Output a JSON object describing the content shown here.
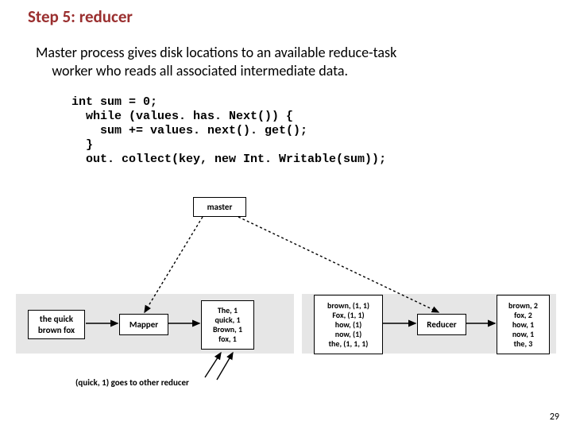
{
  "title": "Step 5: reducer",
  "desc_line1": "Master process gives disk locations to an available reduce-task",
  "desc_line2": "worker who reads all associated intermediate data.",
  "code": "int sum = 0;\n  while (values. has. Next()) {\n    sum += values. next(). get();\n  }\n  out. collect(key, new Int. Writable(sum));",
  "master": "master",
  "input": "the quick\nbrown fox",
  "mapper": "Mapper",
  "mapped": "The, 1\nquick, 1\nBrown, 1\nfox, 1",
  "grouped": "brown, (1, 1)\nFox, (1, 1)\nhow, (1)\nnow, (1)\nthe, (1, 1, 1)",
  "reducer": "Reducer",
  "output": "brown, 2\nfox, 2\nhow, 1\nnow, 1\nthe, 3",
  "note": "(quick, 1) goes to other reducer",
  "pagenum": "29"
}
